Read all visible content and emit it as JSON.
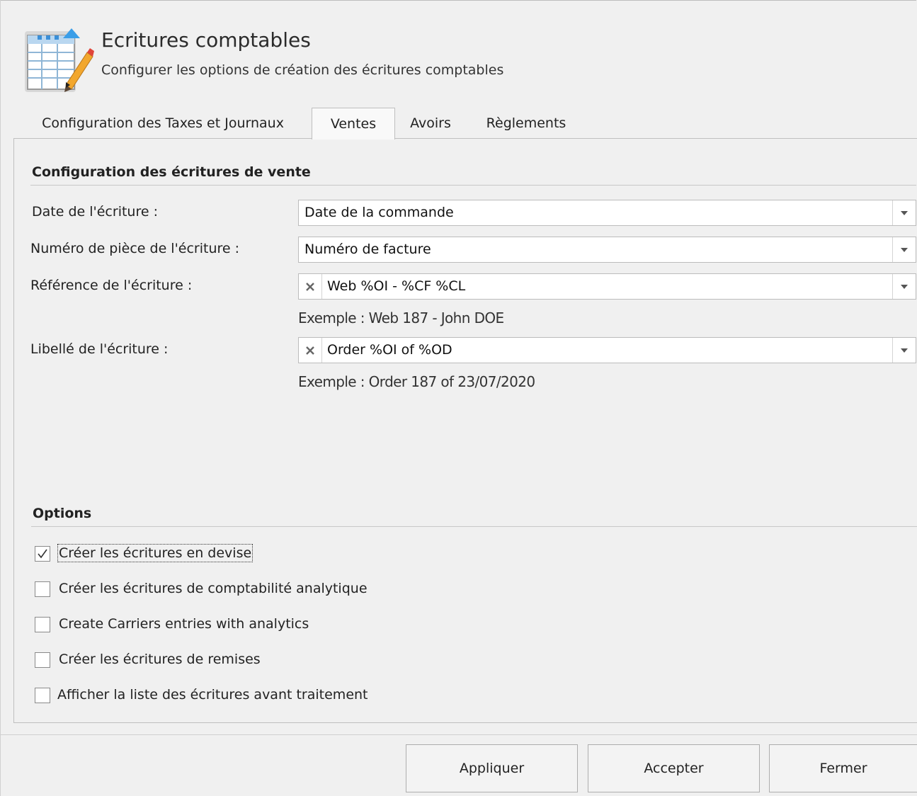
{
  "header": {
    "title": "Ecritures comptables",
    "subtitle": "Configurer les options de création des écritures comptables",
    "icon": "spreadsheet-pencil-icon"
  },
  "tabs": [
    {
      "label": "Configuration des Taxes et Journaux",
      "active": false
    },
    {
      "label": "Ventes",
      "active": true
    },
    {
      "label": "Avoirs",
      "active": false
    },
    {
      "label": "Règlements",
      "active": false
    }
  ],
  "config_section": {
    "title": "Configuration des écritures de vente",
    "fields": [
      {
        "label": "Date de l'écriture :",
        "value": "Date de la commande",
        "clearable": false
      },
      {
        "label": "Numéro de pièce de l'écriture :",
        "value": "Numéro de facture",
        "clearable": false
      },
      {
        "label": "Référence de l'écriture :",
        "value": "Web %OI - %CF %CL",
        "clearable": true,
        "example": "Exemple : Web 187 - John DOE"
      },
      {
        "label": "Libellé de l'écriture :",
        "value": "Order %OI of %OD",
        "clearable": true,
        "example": "Exemple : Order 187 of 23/07/2020"
      }
    ]
  },
  "options_section": {
    "title": "Options",
    "checkboxes": [
      {
        "label": "Créer les écritures en devise",
        "checked": true
      },
      {
        "label": "Créer les écritures de comptabilité analytique",
        "checked": false
      },
      {
        "label": "Create Carriers entries with analytics",
        "checked": false
      },
      {
        "label": "Créer les écritures de remises",
        "checked": false
      },
      {
        "label": "Afficher la liste des écritures avant traitement",
        "checked": false
      }
    ]
  },
  "buttons": {
    "apply": "Appliquer",
    "accept": "Accepter",
    "close": "Fermer"
  }
}
